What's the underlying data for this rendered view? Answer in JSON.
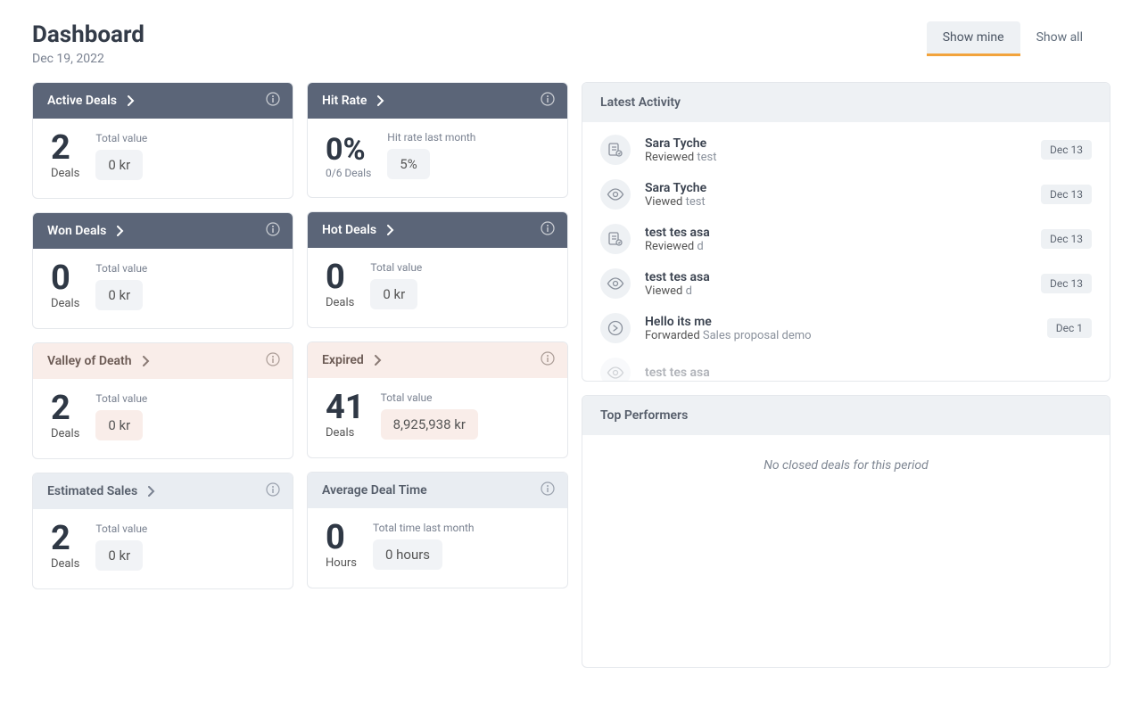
{
  "header": {
    "title": "Dashboard",
    "date": "Dec 19, 2022",
    "tabs": {
      "mine": "Show mine",
      "all": "Show all"
    }
  },
  "cards": {
    "active": {
      "title": "Active Deals",
      "count": "2",
      "count_label": "Deals",
      "sub_label": "Total value",
      "value": "0 kr"
    },
    "hitrate": {
      "title": "Hit Rate",
      "pct": "0%",
      "sub": "0/6 Deals",
      "sub_label": "Hit rate last month",
      "value": "5%"
    },
    "won": {
      "title": "Won Deals",
      "count": "0",
      "count_label": "Deals",
      "sub_label": "Total value",
      "value": "0 kr"
    },
    "hot": {
      "title": "Hot Deals",
      "count": "0",
      "count_label": "Deals",
      "sub_label": "Total value",
      "value": "0 kr"
    },
    "valley": {
      "title": "Valley of Death",
      "count": "2",
      "count_label": "Deals",
      "sub_label": "Total value",
      "value": "0 kr"
    },
    "expired": {
      "title": "Expired",
      "count": "41",
      "count_label": "Deals",
      "sub_label": "Total value",
      "value": "8,925,938 kr"
    },
    "estimated": {
      "title": "Estimated Sales",
      "count": "2",
      "count_label": "Deals",
      "sub_label": "Total value",
      "value": "0 kr"
    },
    "avgtime": {
      "title": "Average Deal Time",
      "count": "0",
      "count_label": "Hours",
      "sub_label": "Total time last month",
      "value": "0 hours"
    }
  },
  "latest": {
    "title": "Latest Activity",
    "items": [
      {
        "icon": "review",
        "name": "Sara Tyche",
        "action": "Reviewed",
        "doc": "test",
        "date": "Dec 13"
      },
      {
        "icon": "view",
        "name": "Sara Tyche",
        "action": "Viewed",
        "doc": "test",
        "date": "Dec 13"
      },
      {
        "icon": "review",
        "name": "test tes asa",
        "action": "Reviewed",
        "doc": "d",
        "date": "Dec 13"
      },
      {
        "icon": "view",
        "name": "test tes asa",
        "action": "Viewed",
        "doc": "d",
        "date": "Dec 13"
      },
      {
        "icon": "forward",
        "name": "Hello its me",
        "action": "Forwarded",
        "doc": "Sales proposal demo",
        "date": "Dec 1"
      },
      {
        "icon": "view",
        "name": "test tes asa",
        "action": "",
        "doc": "",
        "date": ""
      }
    ]
  },
  "top": {
    "title": "Top Performers",
    "empty": "No closed deals for this period"
  }
}
